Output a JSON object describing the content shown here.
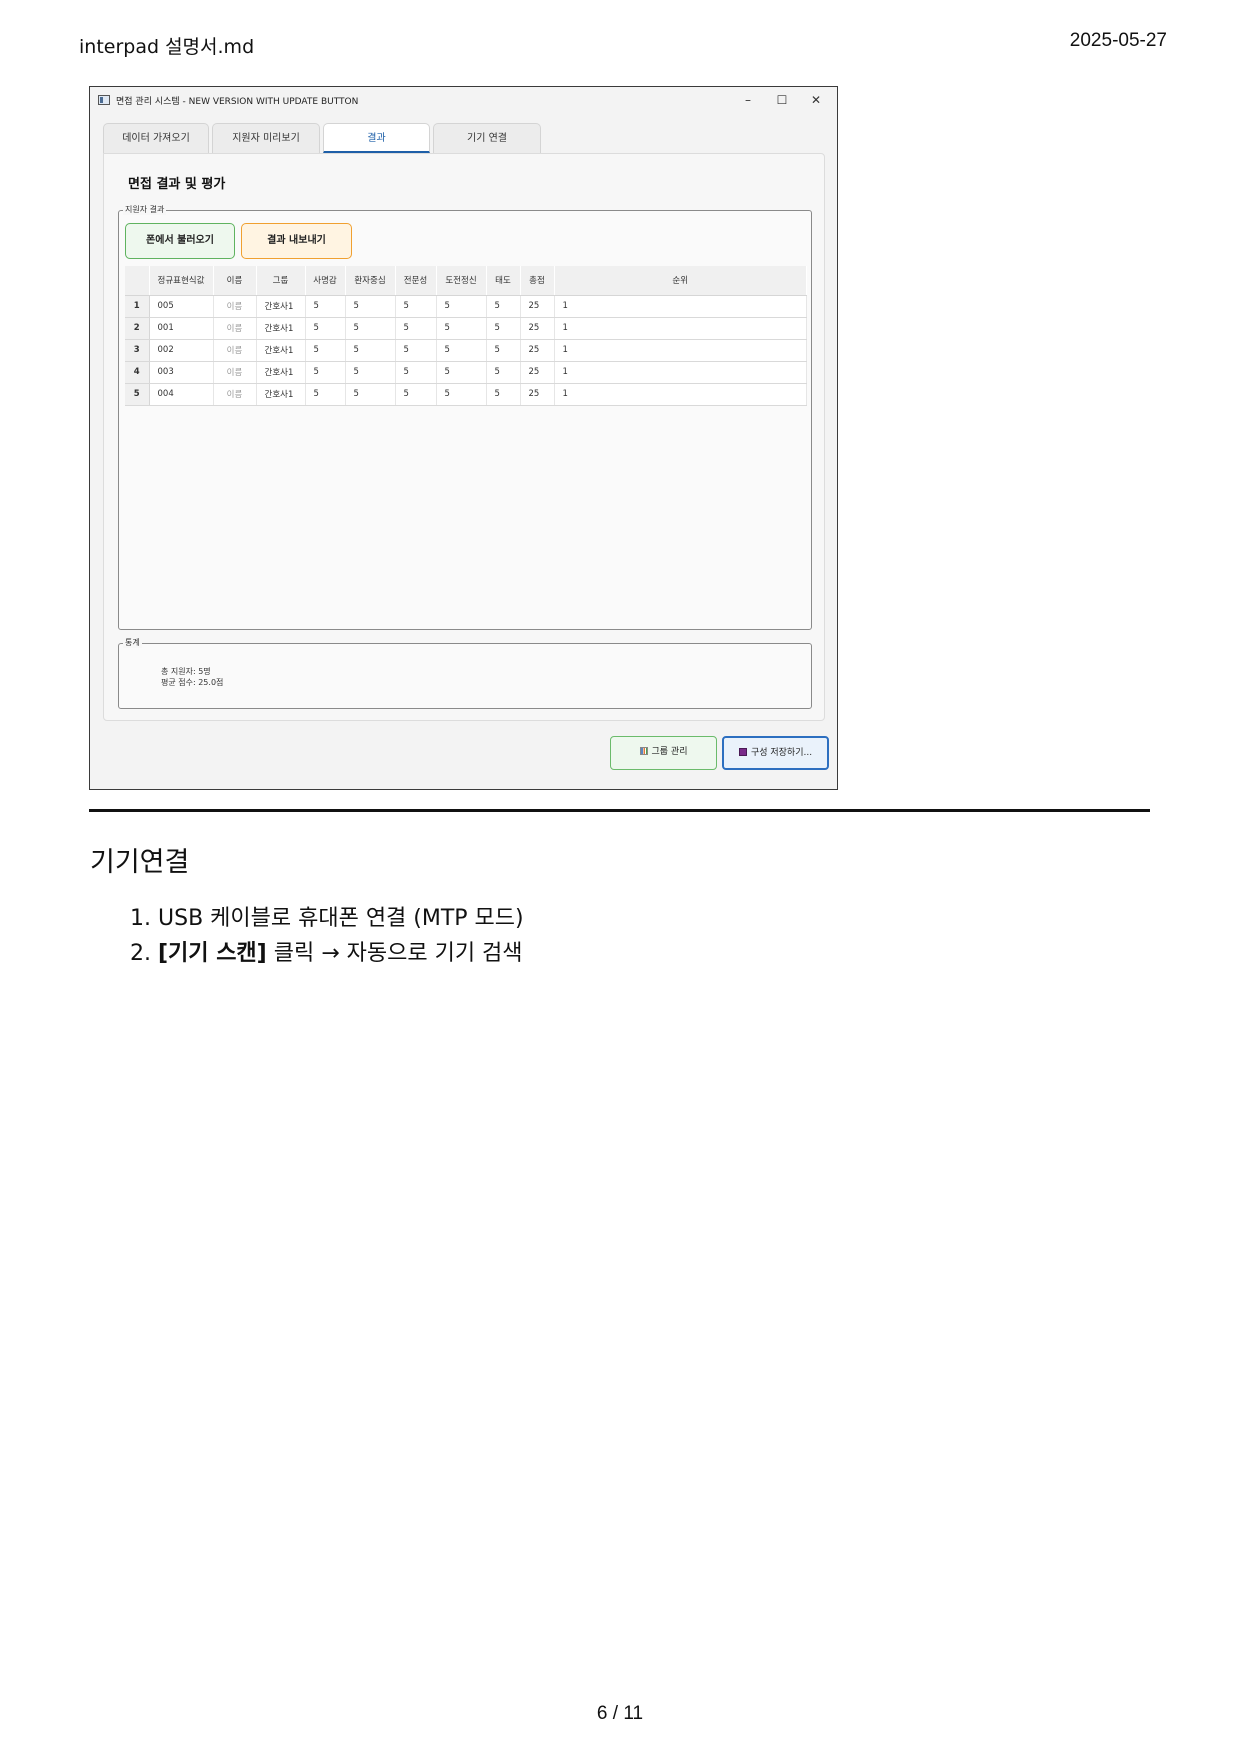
{
  "doc": {
    "header_left": "interpad 설명서.md",
    "header_right": "2025-05-27",
    "section_title": "기기연결",
    "steps": [
      {
        "num": "1.",
        "bold": "",
        "text": "USB 케이블로 휴대폰 연결 (MTP 모드)"
      },
      {
        "num": "2.",
        "bold": "[기기 스캔]",
        "text": " 클릭 → 자동으로 기기 검색"
      }
    ],
    "footer": "6 / 11"
  },
  "window": {
    "title": "면접 관리 시스템 - NEW VERSION WITH UPDATE BUTTON",
    "controls": {
      "minimize": "–",
      "maximize": "☐",
      "close": "✕"
    },
    "tabs": [
      "데이터 가져오기",
      "지원자 미리보기",
      "결과",
      "기기 연결"
    ],
    "active_tab": 2,
    "panel_title": "면접 결과 및 평가",
    "results_group_label": "지원자 결과",
    "buttons": {
      "load_from_phone": "폰에서 불러오기",
      "export_results": "결과 내보내기",
      "group_management": "그룹 관리",
      "save_config": "구성 저장하기..."
    },
    "table": {
      "headers": [
        "",
        "정규표현식값",
        "이름",
        "그룹",
        "사명감",
        "환자중심",
        "전문성",
        "도전정신",
        "태도",
        "총점",
        "순위"
      ],
      "rows": [
        [
          "1",
          "005",
          "이름",
          "간호사1",
          "5",
          "5",
          "5",
          "5",
          "5",
          "25",
          "1"
        ],
        [
          "2",
          "001",
          "이름",
          "간호사1",
          "5",
          "5",
          "5",
          "5",
          "5",
          "25",
          "1"
        ],
        [
          "3",
          "002",
          "이름",
          "간호사1",
          "5",
          "5",
          "5",
          "5",
          "5",
          "25",
          "1"
        ],
        [
          "4",
          "003",
          "이름",
          "간호사1",
          "5",
          "5",
          "5",
          "5",
          "5",
          "25",
          "1"
        ],
        [
          "5",
          "004",
          "이름",
          "간호사1",
          "5",
          "5",
          "5",
          "5",
          "5",
          "25",
          "1"
        ]
      ]
    },
    "stats_group_label": "통계",
    "stats": {
      "total_applicants": "총 지원자: 5명",
      "average_score": "평균 점수: 25.0점"
    }
  }
}
